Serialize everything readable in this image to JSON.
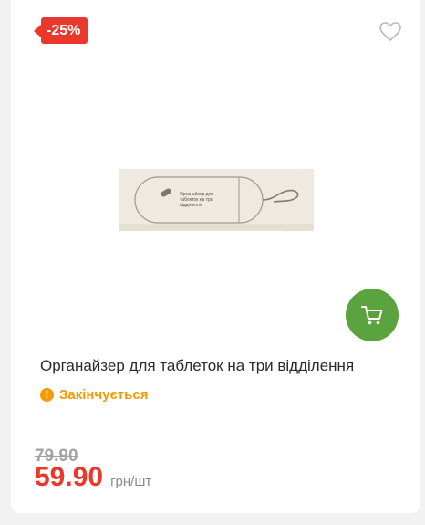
{
  "badge": {
    "discount": "-25%"
  },
  "product": {
    "title": "Органайзер для таблеток на три відділення",
    "status": "Закінчується",
    "old_price": "79.90",
    "price": "59.90",
    "unit": "грн/шт",
    "image_text": "Органайзер для таблеток на три відділення"
  },
  "icons": {
    "favorite": "heart-outline-icon",
    "cart": "cart-icon",
    "status": "exclamation-icon"
  },
  "colors": {
    "accent_red": "#e8392c",
    "cart_green": "#5aa33e",
    "status_orange": "#f39a00"
  }
}
